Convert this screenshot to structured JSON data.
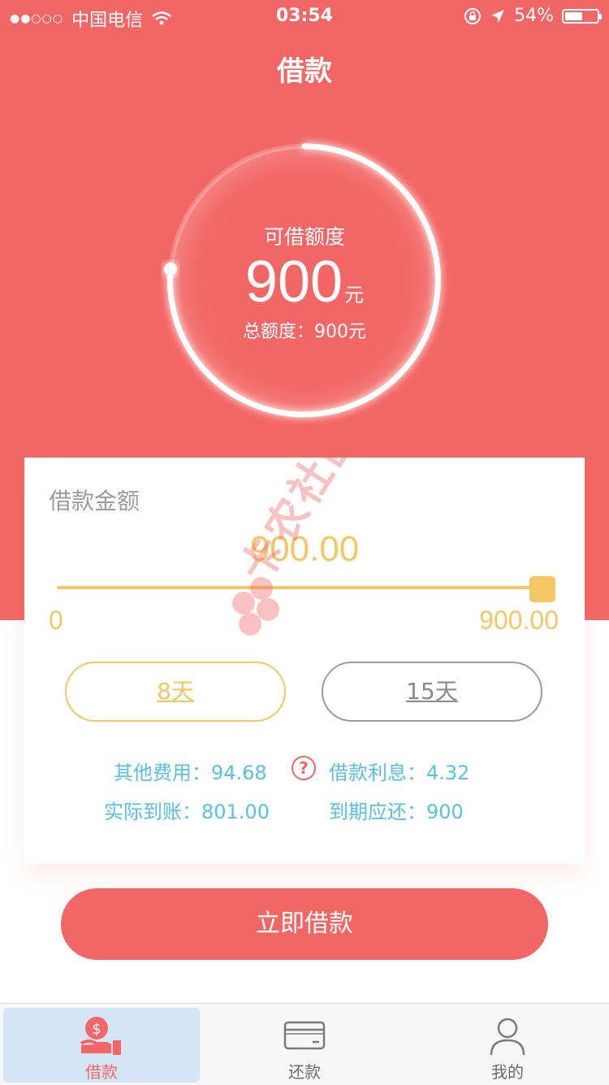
{
  "status_bar": {
    "signal": "●●○○○",
    "carrier": "中国电信",
    "time": "03:54",
    "battery_text": "54%",
    "battery_level": 0.54
  },
  "nav": {
    "title": "借款"
  },
  "gauge": {
    "label": "可借额度",
    "value": "900",
    "unit": "元",
    "total": "总额度：900元"
  },
  "loan": {
    "amount_label": "借款金额",
    "amount_value": "900.00",
    "slider_min": "0",
    "slider_max": "900.00",
    "slider_fraction": 1.0
  },
  "terms": [
    {
      "label": "8天",
      "selected": true
    },
    {
      "label": "15天",
      "selected": false
    }
  ],
  "fees": {
    "other_fee": "其他费用：94.68",
    "interest": "借款利息：4.32",
    "actual_received": "实际到账：801.00",
    "due_amount": "到期应还：900"
  },
  "help_icon_glyph": "?",
  "cta": {
    "label": "立即借款"
  },
  "tabbar": [
    {
      "label": "借款",
      "icon": "loan-hand-dollar-icon",
      "active": true
    },
    {
      "label": "还款",
      "icon": "card-icon",
      "active": false
    },
    {
      "label": "我的",
      "icon": "user-icon",
      "active": false
    }
  ],
  "watermark": {
    "text": "卡农社区"
  },
  "colors": {
    "brand_red": "#f26765",
    "accent_yellow": "#f3c766",
    "info_blue": "#5bbfe3",
    "tab_active_bg": "#d4e6f6"
  }
}
